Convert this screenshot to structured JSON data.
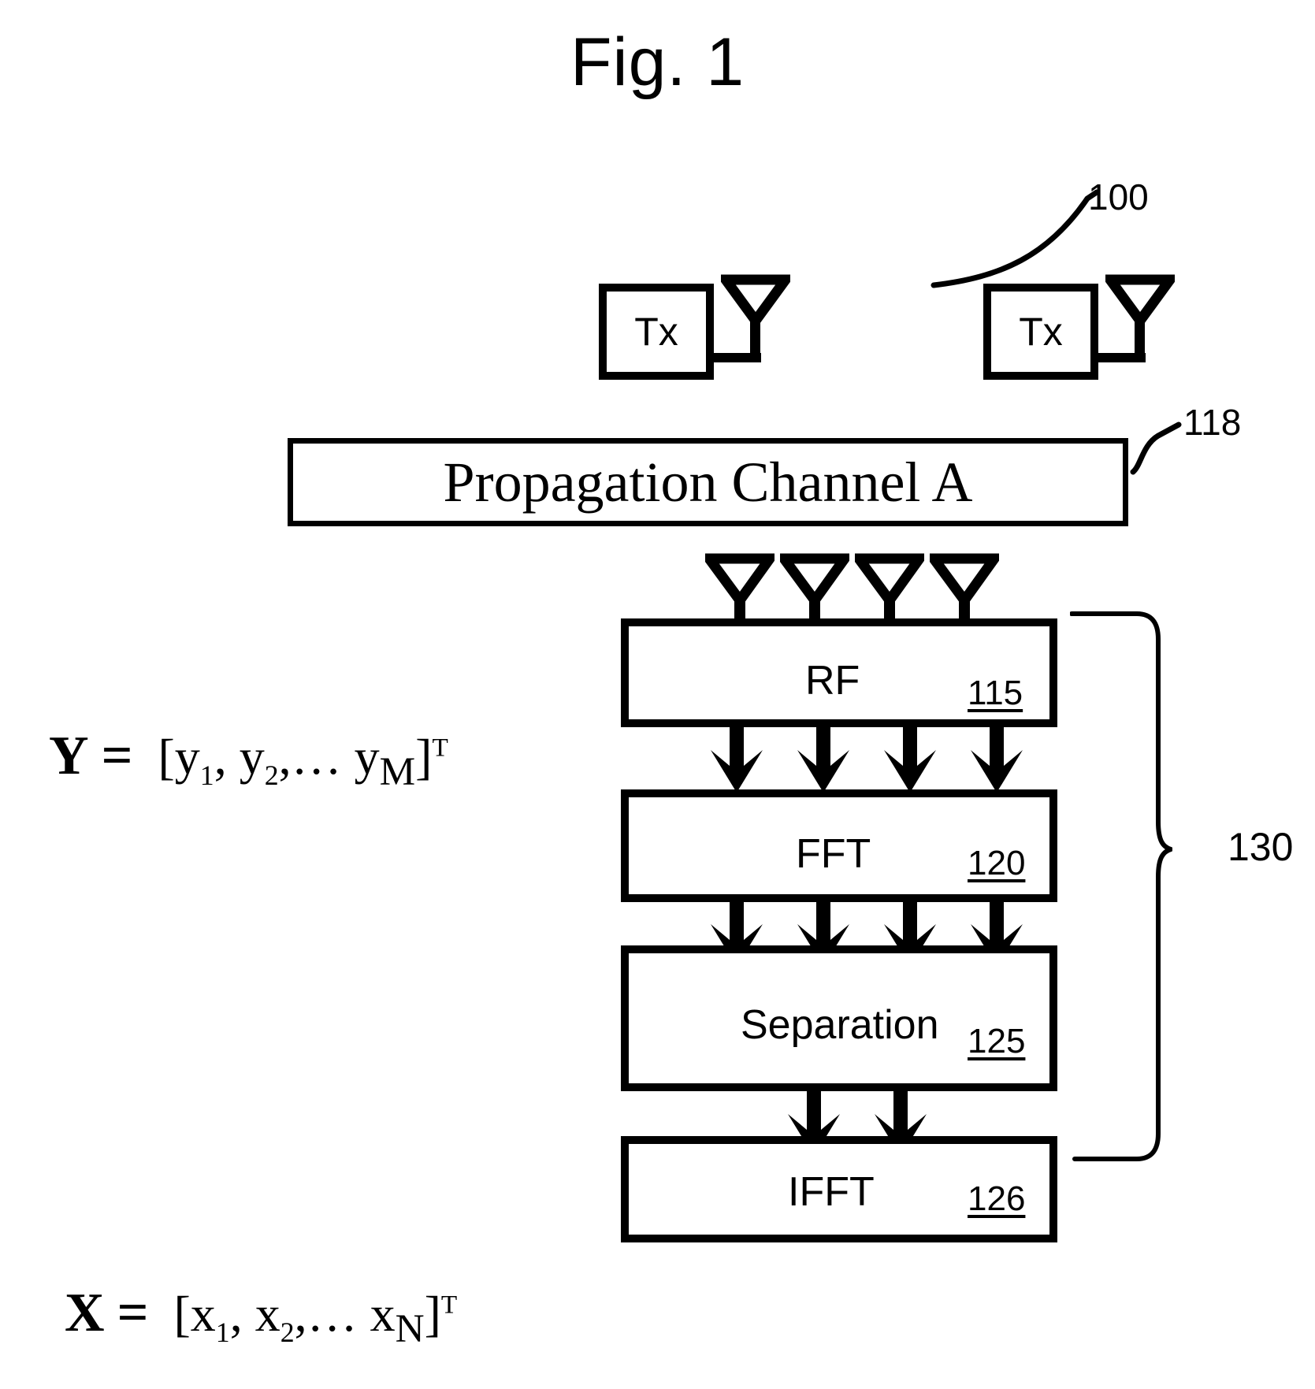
{
  "figure": {
    "title": "Fig. 1"
  },
  "transmitters": [
    {
      "label": "Tx",
      "antenna_icon": "antenna-icon"
    },
    {
      "label": "Tx",
      "antenna_icon": "antenna-icon"
    }
  ],
  "channel": {
    "label": "Propagation Channel A",
    "ref": "118"
  },
  "receiver": {
    "ref": "130",
    "antenna_count": 4,
    "antenna_icon": "antenna-icon",
    "blocks": [
      {
        "label": "RF",
        "ref": "115",
        "arrows_below": 4
      },
      {
        "label": "FFT",
        "ref": "120",
        "arrows_below": 4
      },
      {
        "label": "Separation",
        "ref": "125",
        "arrows_below": 2
      },
      {
        "label": "IFFT",
        "ref": "126",
        "arrows_below": 0
      }
    ]
  },
  "system": {
    "ref": "100"
  },
  "equations": {
    "received": {
      "vector": "Y",
      "equals": "=",
      "open": "[",
      "term1": "y",
      "term1_sub": "1",
      "sep1": ", ",
      "term2": "y",
      "term2_sub": "2",
      "sep2": ",… ",
      "term3": "y",
      "term3_sub": "M",
      "close": "]",
      "transpose": "T"
    },
    "transmitted": {
      "vector": "X",
      "equals": "=",
      "open": "[",
      "term1": "x",
      "term1_sub": "1",
      "sep1": ", ",
      "term2": "x",
      "term2_sub": "2",
      "sep2": ",… ",
      "term3": "x",
      "term3_sub": "N",
      "close": "]",
      "transpose": "T"
    }
  }
}
